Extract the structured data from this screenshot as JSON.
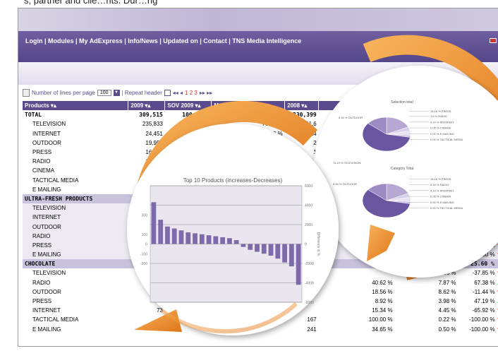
{
  "caption": "s, partner and clie…nts. Dur…ng",
  "nav": {
    "links": "Login | Modules | My AdExpress | Info/News | Updated on | Contact | TNS Media Intelligence"
  },
  "toolbar": {
    "lines_label": "Number of lines per page",
    "lines_value": "100",
    "repeat_label": "| Repeat header",
    "pager": "1 2 3"
  },
  "columns": [
    "Products",
    "2009",
    "SOV 2009",
    "Market share 2009",
    "2008",
    "",
    "",
    ""
  ],
  "rows": [
    {
      "kind": "total",
      "cells": [
        "TOTAL",
        "309,515",
        "100.00 %",
        "100.00 %",
        "330,399",
        "",
        "",
        ""
      ]
    },
    {
      "kind": "sub",
      "cells": [
        "TELEVISION",
        "235,833",
        "100.00 %",
        "76.19 %",
        "261,6",
        "",
        "",
        ""
      ]
    },
    {
      "kind": "sub",
      "cells": [
        "INTERNET",
        "24,451",
        "100.00 %",
        "7.90 %",
        "14",
        "",
        "",
        ""
      ]
    },
    {
      "kind": "sub",
      "cells": [
        "OUTDOOR",
        "19,951",
        "100.00 %",
        "6.45 %",
        "2",
        "",
        "",
        ""
      ]
    },
    {
      "kind": "sub",
      "cells": [
        "PRESS",
        "16,108",
        "100.00 %",
        "5.20 %",
        "1",
        "",
        "",
        ""
      ]
    },
    {
      "kind": "sub",
      "cells": [
        "RADIO",
        "13,063",
        "100.00 %",
        "4.22 %",
        "",
        "",
        "",
        ""
      ]
    },
    {
      "kind": "sub",
      "cells": [
        "CINEMA",
        "105",
        "",
        "",
        "",
        "",
        "",
        ""
      ]
    },
    {
      "kind": "sub",
      "cells": [
        "TACTICAL MEDIA",
        "3",
        "",
        "",
        "",
        "",
        "",
        ""
      ]
    },
    {
      "kind": "sub",
      "cells": [
        "E MAILING",
        "",
        "",
        "",
        "",
        "",
        "",
        ""
      ]
    },
    {
      "kind": "group",
      "cells": [
        "ULTRA-FRESH PRODUCTS",
        "41",
        "",
        "",
        "",
        "",
        "",
        ""
      ]
    },
    {
      "kind": "sub alt",
      "cells": [
        "TELEVISION",
        "3",
        "",
        "",
        "",
        "",
        "",
        ""
      ]
    },
    {
      "kind": "sub alt",
      "cells": [
        "INTERNET",
        "",
        "",
        "",
        "",
        "",
        "",
        ""
      ]
    },
    {
      "kind": "sub alt",
      "cells": [
        "OUTDOOR",
        "",
        "",
        "",
        "",
        "",
        "",
        ".00 %"
      ]
    },
    {
      "kind": "sub alt",
      "cells": [
        "RADIO",
        "",
        "",
        "",
        "",
        "",
        "",
        "81.64 %"
      ]
    },
    {
      "kind": "sub alt",
      "cells": [
        "PRESS",
        "",
        "",
        "",
        "",
        "",
        "",
        "-60.01 %"
      ]
    },
    {
      "kind": "sub alt",
      "cells": [
        "E MAILING",
        "",
        "",
        "",
        "",
        "",
        "",
        "-100.00 %"
      ]
    },
    {
      "kind": "group",
      "cells": [
        "CHOCOLATE",
        "",
        "",
        "",
        "",
        "5.65 %",
        "100.00 %",
        "-25.60 %"
      ]
    },
    {
      "kind": "sub",
      "cells": [
        "TELEVISION",
        "",
        "",
        "",
        "",
        "",
        "74.36 %",
        "-37.85 %"
      ]
    },
    {
      "kind": "sub",
      "cells": [
        "RADIO",
        "",
        "",
        "",
        "",
        "40.62 %",
        "7.87 %",
        "67.38 %"
      ]
    },
    {
      "kind": "sub",
      "cells": [
        "OUTDOOR",
        "",
        "",
        "",
        "",
        "18.56 %",
        "8.62 %",
        "-11.44 %"
      ]
    },
    {
      "kind": "sub",
      "cells": [
        "PRESS",
        "",
        "",
        "",
        "",
        "8.92 %",
        "3.98 %",
        "47.19 %"
      ]
    },
    {
      "kind": "sub",
      "cells": [
        "INTERNET",
        "73",
        "",
        "",
        "",
        "15.34 %",
        "4.45 %",
        "-65.92 %"
      ]
    },
    {
      "kind": "sub",
      "cells": [
        "TACTICAL MEDIA",
        "",
        "",
        "",
        "167",
        "100.00 %",
        "0.22 %",
        "-100.00 %"
      ]
    },
    {
      "kind": "sub",
      "cells": [
        "E MAILING",
        "",
        "",
        "",
        "241",
        "34.65 %",
        "0.50 %",
        "-100.00 %"
      ]
    }
  ],
  "bar_chart": {
    "title": "Top 10 Products (increases-Decreases)",
    "ylabel": "Difference in %",
    "ticks": [
      "6000",
      "4000",
      "2000",
      "0",
      "-2000",
      "-4000",
      "-6000"
    ],
    "left_ticks": [
      "300",
      "",
      "100",
      "0",
      "-100",
      "-200"
    ]
  },
  "pie_chart": {
    "title1": "Selection total",
    "title2": "Category Total",
    "labels1": [
      "18.16 % PRESS",
      "1.6 % RADIO",
      "4.14 % INTERNET",
      "0.05 % CINEMA",
      "0.00 % E MAILING",
      "0.00 % TACTICAL MEDIA",
      "76.19 % TELEVISION",
      "6.45 % OUTDOOR"
    ],
    "labels2": [
      "18.16 % PRESS",
      "4.33 % RADIO",
      "4.14 % INTERNET",
      "0.05 % CINEMA",
      "0.00 % E MAILING",
      "0.00 % TACTICAL MEDIA",
      "6.45 % OUTDOOR"
    ]
  },
  "chart_data": {
    "type": "bar",
    "title": "Top 10 Products (increases-Decreases)",
    "ylabel": "Difference in %",
    "ylim": [
      -6000,
      6000
    ],
    "values": [
      4300,
      2500,
      1800,
      1600,
      1400,
      1200,
      1100,
      1000,
      900,
      800,
      700,
      600,
      400,
      -300,
      -600,
      -800,
      -1000,
      -1200,
      -1500,
      -1900,
      -2300,
      -4200
    ]
  }
}
